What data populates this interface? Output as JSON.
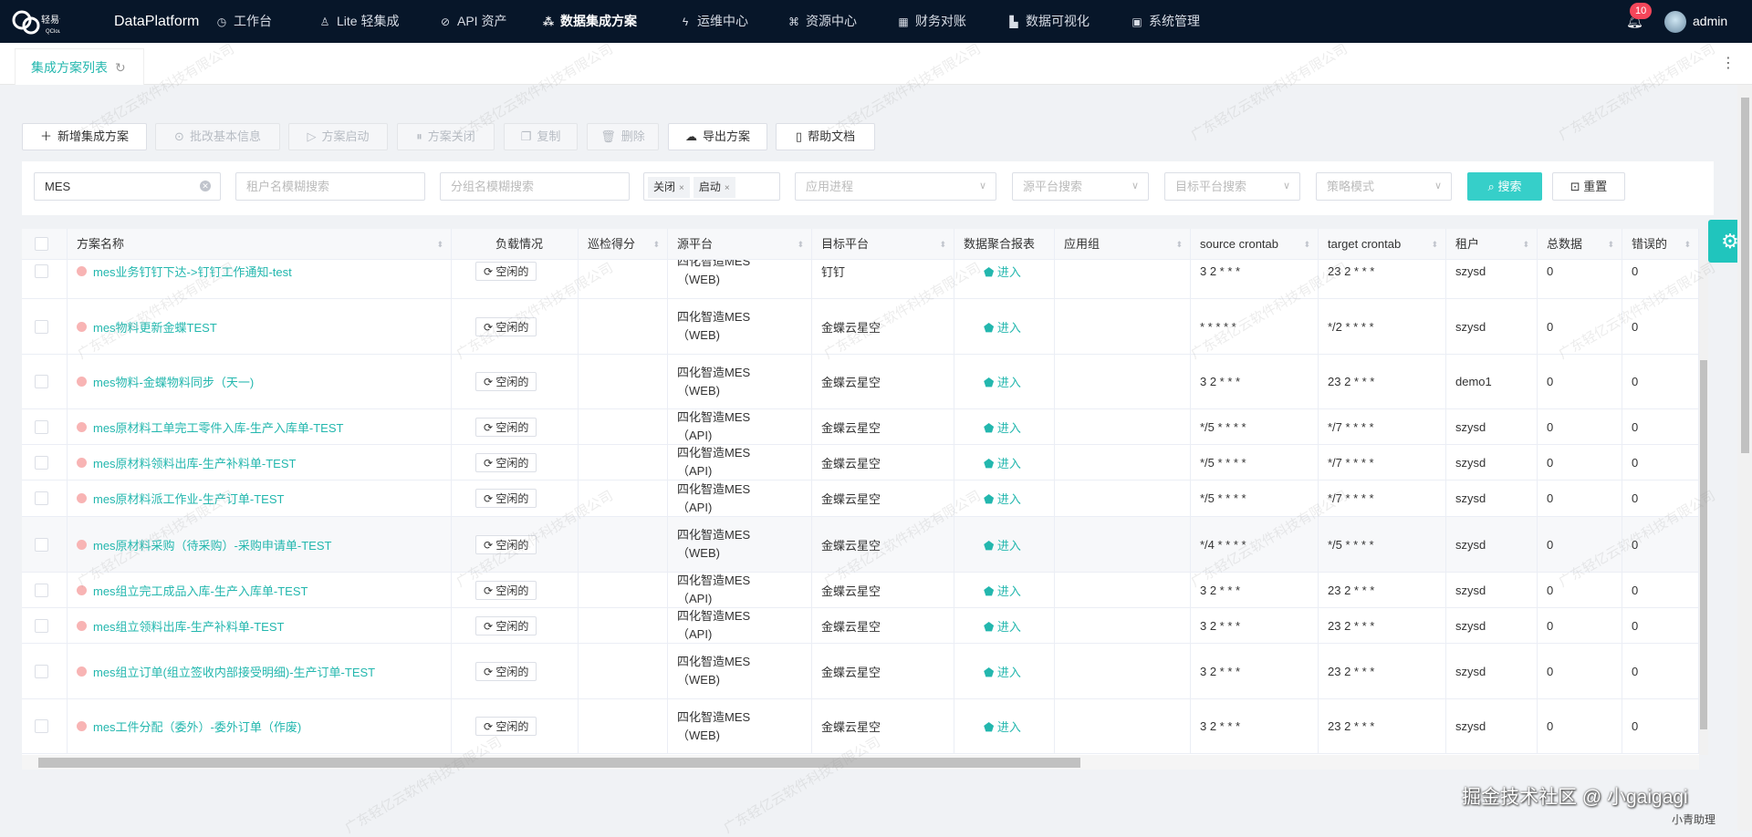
{
  "nav": {
    "brand": "DataPlatform",
    "logo_text": "轻易云 QCloud",
    "items": [
      {
        "label": "工作台",
        "icon": "clock-icon"
      },
      {
        "label": "Lite 轻集成",
        "icon": "lamp-icon"
      },
      {
        "label": "API 资产",
        "icon": "compass-icon"
      },
      {
        "label": "数据集成方案",
        "icon": "network-icon",
        "active": true
      },
      {
        "label": "运维中心",
        "icon": "bolt-icon"
      },
      {
        "label": "资源中心",
        "icon": "cluster-icon"
      },
      {
        "label": "财务对账",
        "icon": "calculator-icon"
      },
      {
        "label": "数据可视化",
        "icon": "chart-icon"
      },
      {
        "label": "系统管理",
        "icon": "grid-icon"
      }
    ],
    "notifications": "10",
    "user": "admin"
  },
  "tab": {
    "label": "集成方案列表"
  },
  "toolbar": {
    "new": "新增集成方案",
    "batch": "批改基本信息",
    "start": "方案启动",
    "close": "方案关闭",
    "copy": "复制",
    "delete": "删除",
    "export": "导出方案",
    "help": "帮助文档"
  },
  "filters": {
    "keyword": "MES",
    "tenant_ph": "租户名模糊搜索",
    "group_ph": "分组名模糊搜索",
    "tags": [
      "关闭",
      "启动"
    ],
    "process_ph": "应用进程",
    "source_ph": "源平台搜索",
    "target_ph": "目标平台搜索",
    "strategy_ph": "策略模式",
    "search": "搜索",
    "reset": "重置"
  },
  "columns": [
    "方案名称",
    "负载情况",
    "巡检得分",
    "源平台",
    "目标平台",
    "数据聚合报表",
    "应用组",
    "source crontab",
    "target crontab",
    "租户",
    "总数据",
    "错误的"
  ],
  "rows": [
    {
      "name": "mes业务钉钉下达->钉钉工作通知-test",
      "load": "空闲的",
      "src": "四化智造MES（WEB)",
      "dst": "钉钉",
      "report": "进入",
      "sc": "3 2 * * *",
      "tc": "23 2 * * *",
      "tenant": "szysd",
      "total": "0",
      "err": "0",
      "h": 61
    },
    {
      "name": "mes物料更新金蝶TEST",
      "load": "空闲的",
      "src": "四化智造MES（WEB)",
      "dst": "金蝶云星空",
      "report": "进入",
      "sc": "* * * * *",
      "tc": "*/2 * * * *",
      "tenant": "szysd",
      "total": "0",
      "err": "0",
      "h": 61
    },
    {
      "name": "mes物料-金蝶物料同步（天一)",
      "load": "空闲的",
      "src": "四化智造MES（WEB)",
      "dst": "金蝶云星空",
      "report": "进入",
      "sc": "3 2 * * *",
      "tc": "23 2 * * *",
      "tenant": "demo1",
      "total": "0",
      "err": "0",
      "h": 60
    },
    {
      "name": "mes原材料工单完工零件入库-生产入库单-TEST",
      "load": "空闲的",
      "src": "四化智造MES（API)",
      "dst": "金蝶云星空",
      "report": "进入",
      "sc": "*/5 * * * *",
      "tc": "*/7 * * * *",
      "tenant": "szysd",
      "total": "0",
      "err": "0",
      "h": 39
    },
    {
      "name": "mes原材料领料出库-生产补料单-TEST",
      "load": "空闲的",
      "src": "四化智造MES（API)",
      "dst": "金蝶云星空",
      "report": "进入",
      "sc": "*/5 * * * *",
      "tc": "*/7 * * * *",
      "tenant": "szysd",
      "total": "0",
      "err": "0",
      "h": 39
    },
    {
      "name": "mes原材料派工作业-生产订单-TEST",
      "load": "空闲的",
      "src": "四化智造MES（API)",
      "dst": "金蝶云星空",
      "report": "进入",
      "sc": "*/5 * * * *",
      "tc": "*/7 * * * *",
      "tenant": "szysd",
      "total": "0",
      "err": "0",
      "h": 40
    },
    {
      "name": "mes原材料采购（待采购）-采购申请单-TEST",
      "load": "空闲的",
      "src": "四化智造MES（WEB)",
      "dst": "金蝶云星空",
      "report": "进入",
      "sc": "*/4 * * * *",
      "tc": "*/5 * * * *",
      "tenant": "szysd",
      "total": "0",
      "err": "0",
      "h": 61,
      "hl": true
    },
    {
      "name": "mes组立完工成品入库-生产入库单-TEST",
      "load": "空闲的",
      "src": "四化智造MES（API)",
      "dst": "金蝶云星空",
      "report": "进入",
      "sc": "3 2 * * *",
      "tc": "23 2 * * *",
      "tenant": "szysd",
      "total": "0",
      "err": "0",
      "h": 39
    },
    {
      "name": "mes组立领料出库-生产补料单-TEST",
      "load": "空闲的",
      "src": "四化智造MES（API)",
      "dst": "金蝶云星空",
      "report": "进入",
      "sc": "3 2 * * *",
      "tc": "23 2 * * *",
      "tenant": "szysd",
      "total": "0",
      "err": "0",
      "h": 39
    },
    {
      "name": "mes组立订单(组立签收内部接受明细)-生产订单-TEST",
      "load": "空闲的",
      "src": "四化智造MES（WEB)",
      "dst": "金蝶云星空",
      "report": "进入",
      "sc": "3 2 * * *",
      "tc": "23 2 * * *",
      "tenant": "szysd",
      "total": "0",
      "err": "0",
      "h": 61
    },
    {
      "name": "mes工件分配（委外）-委外订单（作废)",
      "load": "空闲的",
      "src": "四化智造MES（WEB)",
      "dst": "金蝶云星空",
      "report": "进入",
      "sc": "3 2 * * *",
      "tc": "23 2 * * *",
      "tenant": "szysd",
      "total": "0",
      "err": "0",
      "h": 60
    }
  ],
  "watermark": "广东轻亿云软件科技有限公司",
  "overlay": {
    "community": "掘金技术社区 @ 小gaigagi",
    "assistant": "小青助理"
  },
  "colors": {
    "nav_bg": "#071629",
    "accent": "#36cfc9",
    "link": "#23b7ae",
    "badge": "#f5465a"
  }
}
